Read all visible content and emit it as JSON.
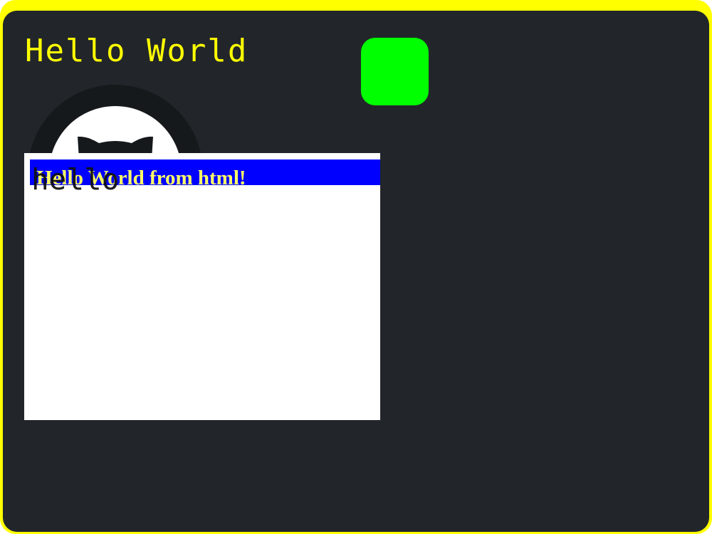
{
  "app": {
    "title": "Hello World"
  },
  "logo": {
    "icon": "github-octocat-icon"
  },
  "accent_square": {
    "color": "#00ff00"
  },
  "html_panel": {
    "heading": "Hello World from html!",
    "overlay_text": "hello"
  },
  "colors": {
    "frame_border": "#ffff00",
    "panel_background": "#22262a",
    "title_text": "#ffff00",
    "banner_background": "#0000ff",
    "banner_text": "#ffff66"
  }
}
